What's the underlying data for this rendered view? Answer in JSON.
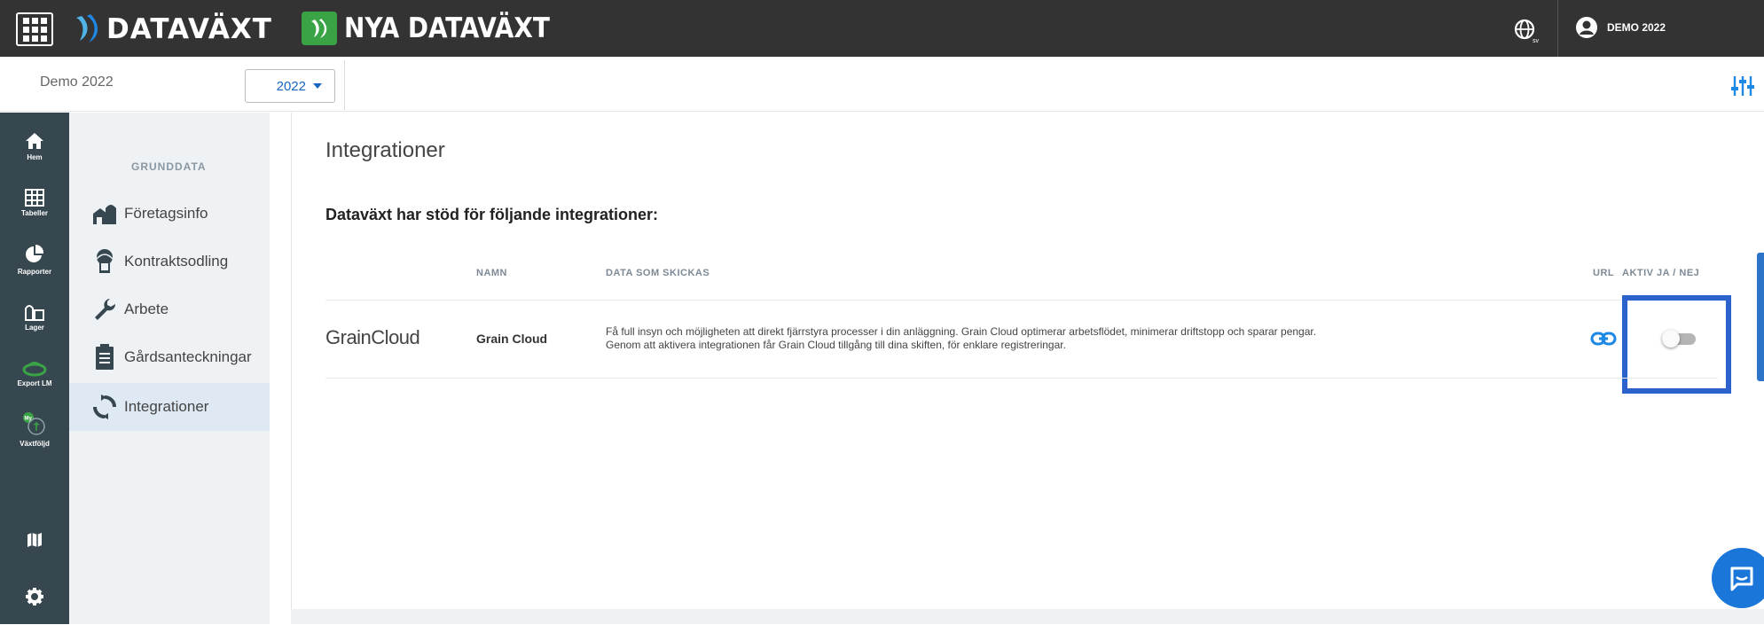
{
  "topbar": {
    "brand": "DATAVÄXT",
    "new_brand": "NYA DATAVÄXT",
    "lang_code": "sv",
    "user_label": "DEMO 2022"
  },
  "subbar": {
    "company": "Demo 2022",
    "year": "2022"
  },
  "leftnav": {
    "items": [
      {
        "label": "Hem",
        "icon": "home-icon"
      },
      {
        "label": "Tabeller",
        "icon": "table-icon"
      },
      {
        "label": "Rapporter",
        "icon": "pie-chart-icon"
      },
      {
        "label": "Lager",
        "icon": "warehouse-icon"
      },
      {
        "label": "Export LM",
        "icon": "export-lm-icon"
      },
      {
        "label": "Växtföljd",
        "icon": "crop-rotation-icon"
      }
    ],
    "bottom_icons": [
      "map-icon",
      "gear-icon"
    ]
  },
  "submenu": {
    "header": "GRUNDDATA",
    "items": [
      {
        "label": "Företagsinfo",
        "icon": "farm-icon"
      },
      {
        "label": "Kontraktsodling",
        "icon": "contract-icon"
      },
      {
        "label": "Arbete",
        "icon": "wrench-icon"
      },
      {
        "label": "Gårdsanteckningar",
        "icon": "notes-icon"
      },
      {
        "label": "Integrationer",
        "icon": "sync-icon"
      }
    ]
  },
  "main": {
    "title": "Integrationer",
    "lead": "Dataväxt har stöd för följande integrationer:",
    "columns": {
      "name": "NAMN",
      "data": "DATA SOM SKICKAS",
      "url": "URL",
      "active": "AKTIV JA / NEJ"
    },
    "rows": [
      {
        "logo": "GrainCloud",
        "name": "Grain Cloud",
        "description_1": "Få full insyn och möjligheten att direkt fjärrstyra processer i din anläggning. Grain Cloud optimerar arbetsflödet, minimerar driftstopp och sparar pengar.",
        "description_2": "Genom att aktivera integrationen får Grain Cloud tillgång till dina skiften, för enklare registreringar.",
        "active": false
      }
    ]
  },
  "colors": {
    "topbar": "#333333",
    "leftnav": "#37474f",
    "accent_blue": "#1565c0",
    "highlight": "#2b62cc",
    "green": "#3aa346"
  }
}
